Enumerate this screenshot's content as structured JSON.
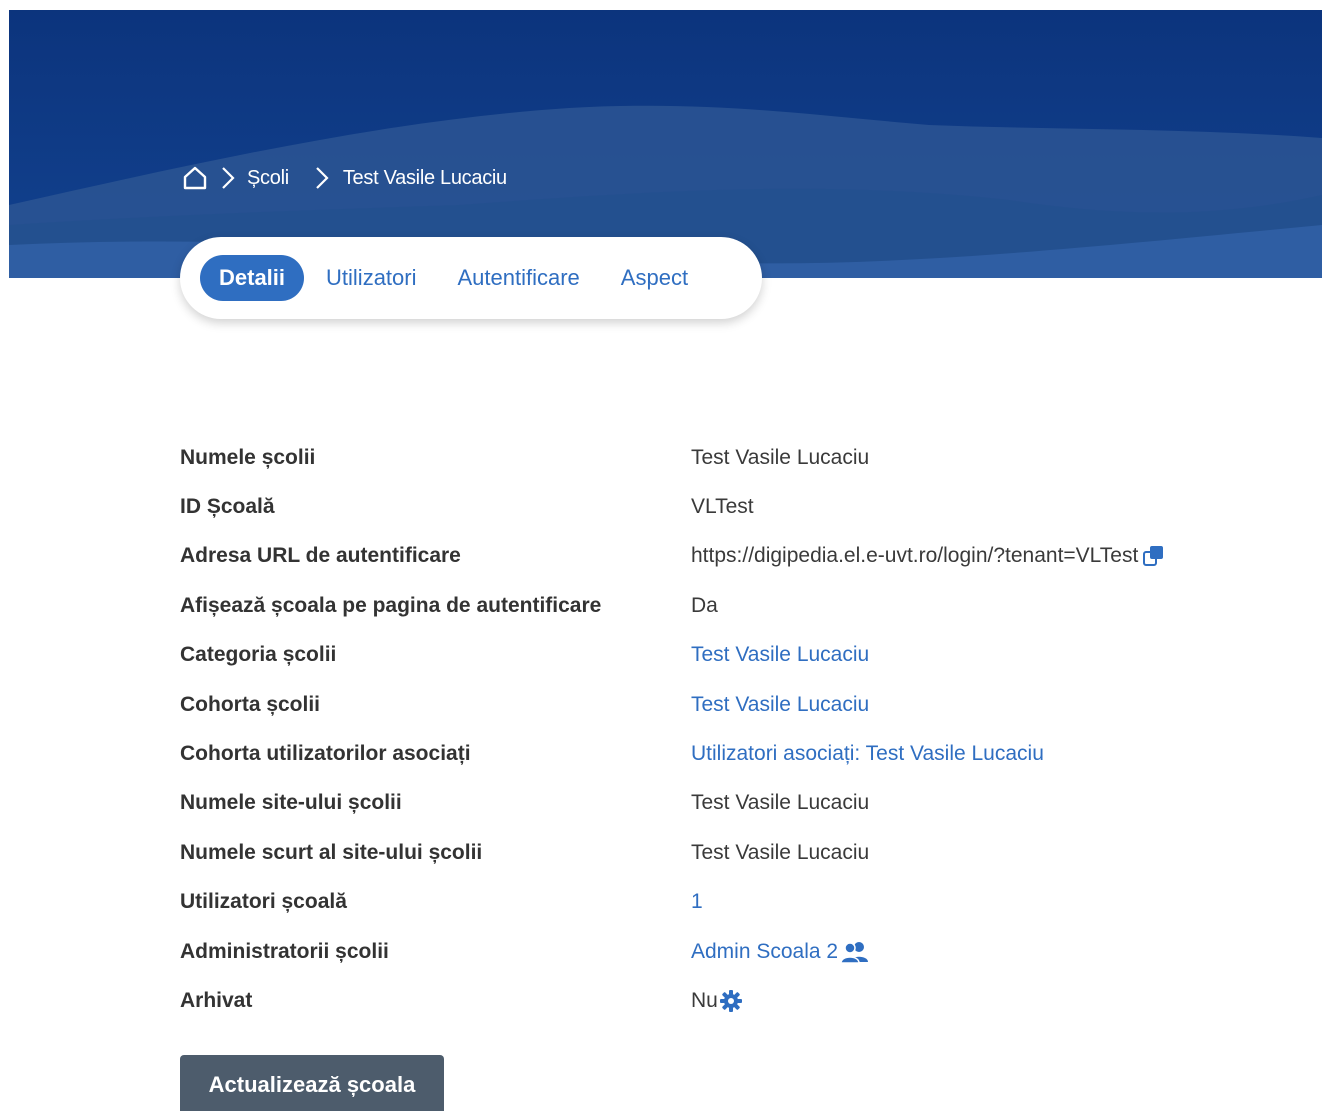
{
  "breadcrumb": {
    "home_icon": "home-icon",
    "separator_icon": "chevron-right-icon",
    "schools_label": "Școli",
    "current_label": "Test Vasile Lucaciu"
  },
  "tabs": [
    {
      "label": "Detalii",
      "active": true
    },
    {
      "label": "Utilizatori",
      "active": false
    },
    {
      "label": "Autentificare",
      "active": false
    },
    {
      "label": "Aspect",
      "active": false
    }
  ],
  "details": {
    "school_name": {
      "label": "Numele școlii",
      "value": "Test Vasile Lucaciu"
    },
    "school_id": {
      "label": "ID Școală",
      "value": "VLTest"
    },
    "login_url": {
      "label": "Adresa URL de autentificare",
      "value": "https://digipedia.el.e-uvt.ro/login/?tenant=VLTest",
      "icon": "copy-icon"
    },
    "show_on_login": {
      "label": "Afișează școala pe pagina de autentificare",
      "value": "Da"
    },
    "category": {
      "label": "Categoria școlii",
      "value": "Test Vasile Lucaciu"
    },
    "cohort": {
      "label": "Cohorta școlii",
      "value": "Test Vasile Lucaciu"
    },
    "associated_cohort": {
      "label": "Cohorta utilizatorilor asociați",
      "value": "Utilizatori asociați: Test Vasile Lucaciu"
    },
    "site_name": {
      "label": "Numele site-ului școlii",
      "value": "Test Vasile Lucaciu"
    },
    "site_shortname": {
      "label": "Numele scurt al site-ului școlii",
      "value": "Test Vasile Lucaciu"
    },
    "users": {
      "label": "Utilizatori școală",
      "value": "1"
    },
    "admins": {
      "label": "Administratorii școlii",
      "value": "Admin Scoala 2",
      "icon": "users-icon"
    },
    "archived": {
      "label": "Arhivat",
      "value": "Nu",
      "icon": "gear-icon"
    }
  },
  "actions": {
    "update_label": "Actualizează școala"
  },
  "colors": {
    "banner": "#0f3a86",
    "accent": "#2f6ec1",
    "button": "#4d5c6c"
  }
}
